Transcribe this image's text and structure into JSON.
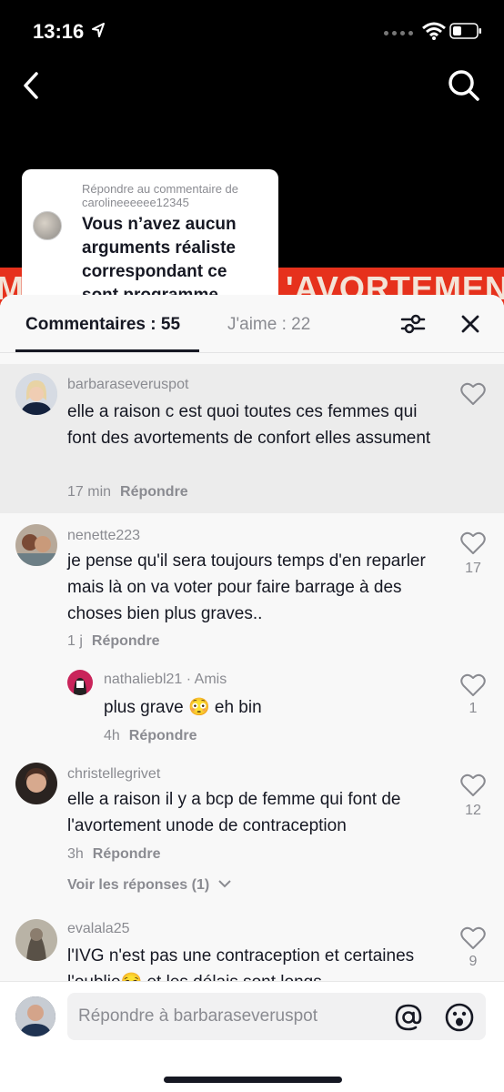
{
  "status_bar": {
    "time": "13:16"
  },
  "video": {
    "banner_left": "M",
    "banner_right": "'AVORTEMENT",
    "reply_card": {
      "caption": "Répondre au commentaire de carolineeeeee12345",
      "quote": "Vous n’avez aucun arguments réaliste correspondant ce sont programme"
    }
  },
  "sheet": {
    "tab_comments": "Commentaires : 55",
    "tab_likes": "J'aime : 22",
    "comments": [
      {
        "username": "barbaraseveruspot",
        "text": "elle a raison c est quoi toutes ces femmes qui font des avortements de confort elles assument",
        "time": "17 min",
        "reply": "Répondre",
        "likes": ""
      },
      {
        "username": "nenette223",
        "text": "je pense qu'il sera toujours temps d'en reparler mais là on va voter pour faire barrage à des choses bien plus graves..",
        "time": "1 j",
        "reply": "Répondre",
        "likes": "17"
      },
      {
        "username": "nathaliebl21",
        "badge": "· Amis",
        "text": "plus grave 😳 eh bin",
        "time": "4h",
        "reply": "Répondre",
        "likes": "1"
      },
      {
        "username": "christellegrivet",
        "text": "elle a raison il y a bcp de femme qui font de l'avortement unode de contraception",
        "time": "3h",
        "reply": "Répondre",
        "likes": "12",
        "view_replies": "Voir les réponses (1)"
      },
      {
        "username": "evalala25",
        "text": "l'IVG n'est pas une contraception et certaines l'oublie😏 et les délais sont longs",
        "likes": "9"
      }
    ]
  },
  "input": {
    "placeholder": "Répondre à barbaraseveruspot"
  }
}
